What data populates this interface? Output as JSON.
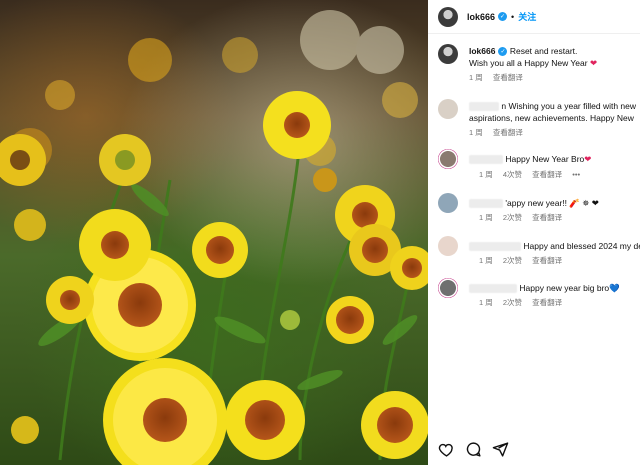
{
  "post": {
    "username": "lok666",
    "follow_separator": "•",
    "follow_label": "关注"
  },
  "caption": {
    "username": "lok666",
    "line1": "Reset and restart.",
    "line2": "Wish you all a Happy New Year",
    "emoji": "❤",
    "time": "1 周",
    "translate": "查看翻译"
  },
  "comments": [
    {
      "text": "n Wishing you a year filled with new",
      "text2": "aspirations, new achievements. Happy New",
      "time": "1 周",
      "likes": "",
      "translate": "查看翻译"
    },
    {
      "text": "Happy New Year Bro",
      "emoji": "❤",
      "time": "1 周",
      "likes": "4次赞",
      "translate": "查看翻译",
      "more": "•••"
    },
    {
      "text": "'appy new year!! 🧨 ✵ ❤",
      "time": "1 周",
      "likes": "2次赞",
      "translate": "查看翻译"
    },
    {
      "text": "Happy and blessed 2024 my de",
      "time": "1 周",
      "likes": "2次赞",
      "translate": "查看翻译"
    },
    {
      "text": "Happy new year big bro",
      "emoji": "💙",
      "time": "1 周",
      "likes": "2次赞",
      "translate": "查看翻译"
    }
  ],
  "icons": [
    "heart-icon",
    "comment-icon",
    "share-icon"
  ],
  "colors": {
    "link": "#0095f6",
    "meta": "#737373",
    "verified": "#1d9bf0",
    "heart": "#e0245e"
  }
}
